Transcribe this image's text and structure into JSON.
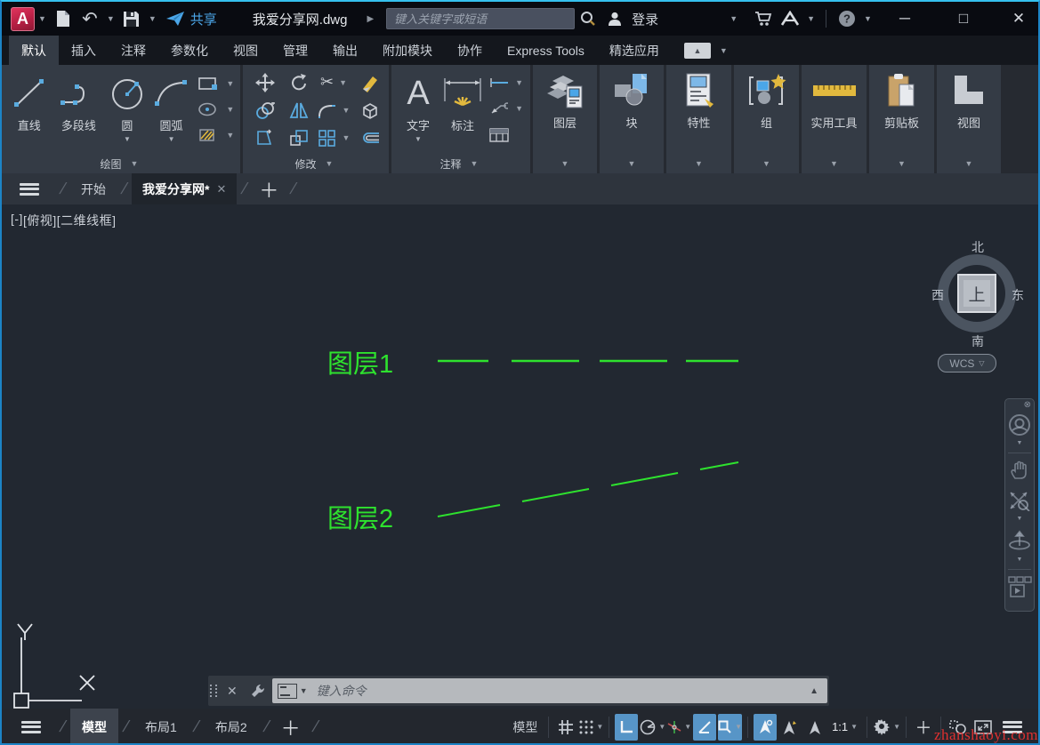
{
  "titlebar": {
    "filename": "我爱分享网.dwg",
    "share_label": "共享",
    "search_placeholder": "键入关键字或短语",
    "login_label": "登录"
  },
  "ribbon": {
    "tabs": [
      "默认",
      "插入",
      "注释",
      "参数化",
      "视图",
      "管理",
      "输出",
      "附加模块",
      "协作",
      "Express Tools",
      "精选应用"
    ],
    "active_tab": "默认",
    "draw_panel": {
      "title": "绘图",
      "line": "直线",
      "polyline": "多段线",
      "circle": "圆",
      "arc": "圆弧"
    },
    "modify_panel": {
      "title": "修改"
    },
    "annotation_panel": {
      "title": "注释",
      "text": "文字",
      "dimension": "标注"
    },
    "collapsed_panels": {
      "layers": "图层",
      "block": "块",
      "properties": "特性",
      "group": "组",
      "utilities": "实用工具",
      "clipboard": "剪贴板",
      "view": "视图"
    }
  },
  "file_tabs": {
    "start": "开始",
    "active": "我爱分享网*"
  },
  "viewport": {
    "vp_control": "[-]",
    "view_control": "[俯视]",
    "visual_control": "[二维线框]",
    "viewcube": {
      "north": "北",
      "south": "南",
      "east": "东",
      "west": "西",
      "top": "上",
      "wcs": "WCS"
    }
  },
  "canvas": {
    "layer1_label": "图层1",
    "layer2_label": "图层2",
    "line_color": "#2ee22e"
  },
  "command_line": {
    "placeholder": "键入命令"
  },
  "status_bar": {
    "model_tab": "模型",
    "layout1": "布局1",
    "layout2": "布局2",
    "model_space": "模型",
    "annotation_scale": "1:1",
    "watermark": "zhanshaoyi.com"
  },
  "colors": {
    "accent_blue": "#4ba6e8",
    "toggle_active": "#5795c7",
    "entity_green": "#2ee22e",
    "logo_red": "#c2203e",
    "watermark_red": "#e03030"
  }
}
